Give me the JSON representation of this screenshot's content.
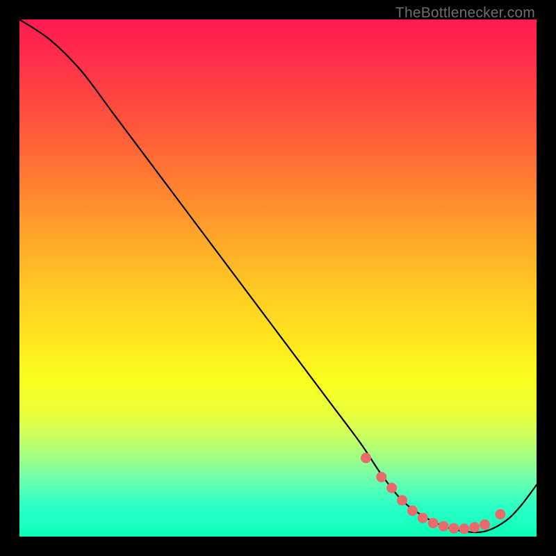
{
  "watermark": "TheBottlenecker.com",
  "chart_data": {
    "type": "line",
    "title": "",
    "xlabel": "",
    "ylabel": "",
    "xlim": [
      0,
      100
    ],
    "ylim": [
      0,
      100
    ],
    "grid": false,
    "legend": false,
    "background": "red-yellow-green vertical gradient",
    "series": [
      {
        "name": "bottleneck-curve",
        "x": [
          0,
          6,
          12,
          18,
          24,
          30,
          36,
          42,
          48,
          54,
          60,
          66,
          70,
          74,
          78,
          82,
          86,
          90,
          94,
          97,
          100
        ],
        "values": [
          100,
          96,
          90,
          82,
          74,
          66,
          58,
          50,
          42,
          34,
          26,
          18,
          12,
          7,
          4,
          2,
          1,
          1,
          3,
          6,
          10
        ]
      }
    ],
    "markers": {
      "name": "highlight-dots",
      "x": [
        67,
        70,
        72,
        74,
        76,
        78,
        80,
        82,
        84,
        86,
        88,
        90,
        93
      ],
      "values": [
        15.2,
        11.5,
        9.4,
        7.0,
        5.0,
        3.6,
        2.6,
        2.0,
        1.6,
        1.5,
        1.8,
        2.3,
        4.3
      ],
      "color": "#e96a6a",
      "radius": 7.5
    }
  }
}
